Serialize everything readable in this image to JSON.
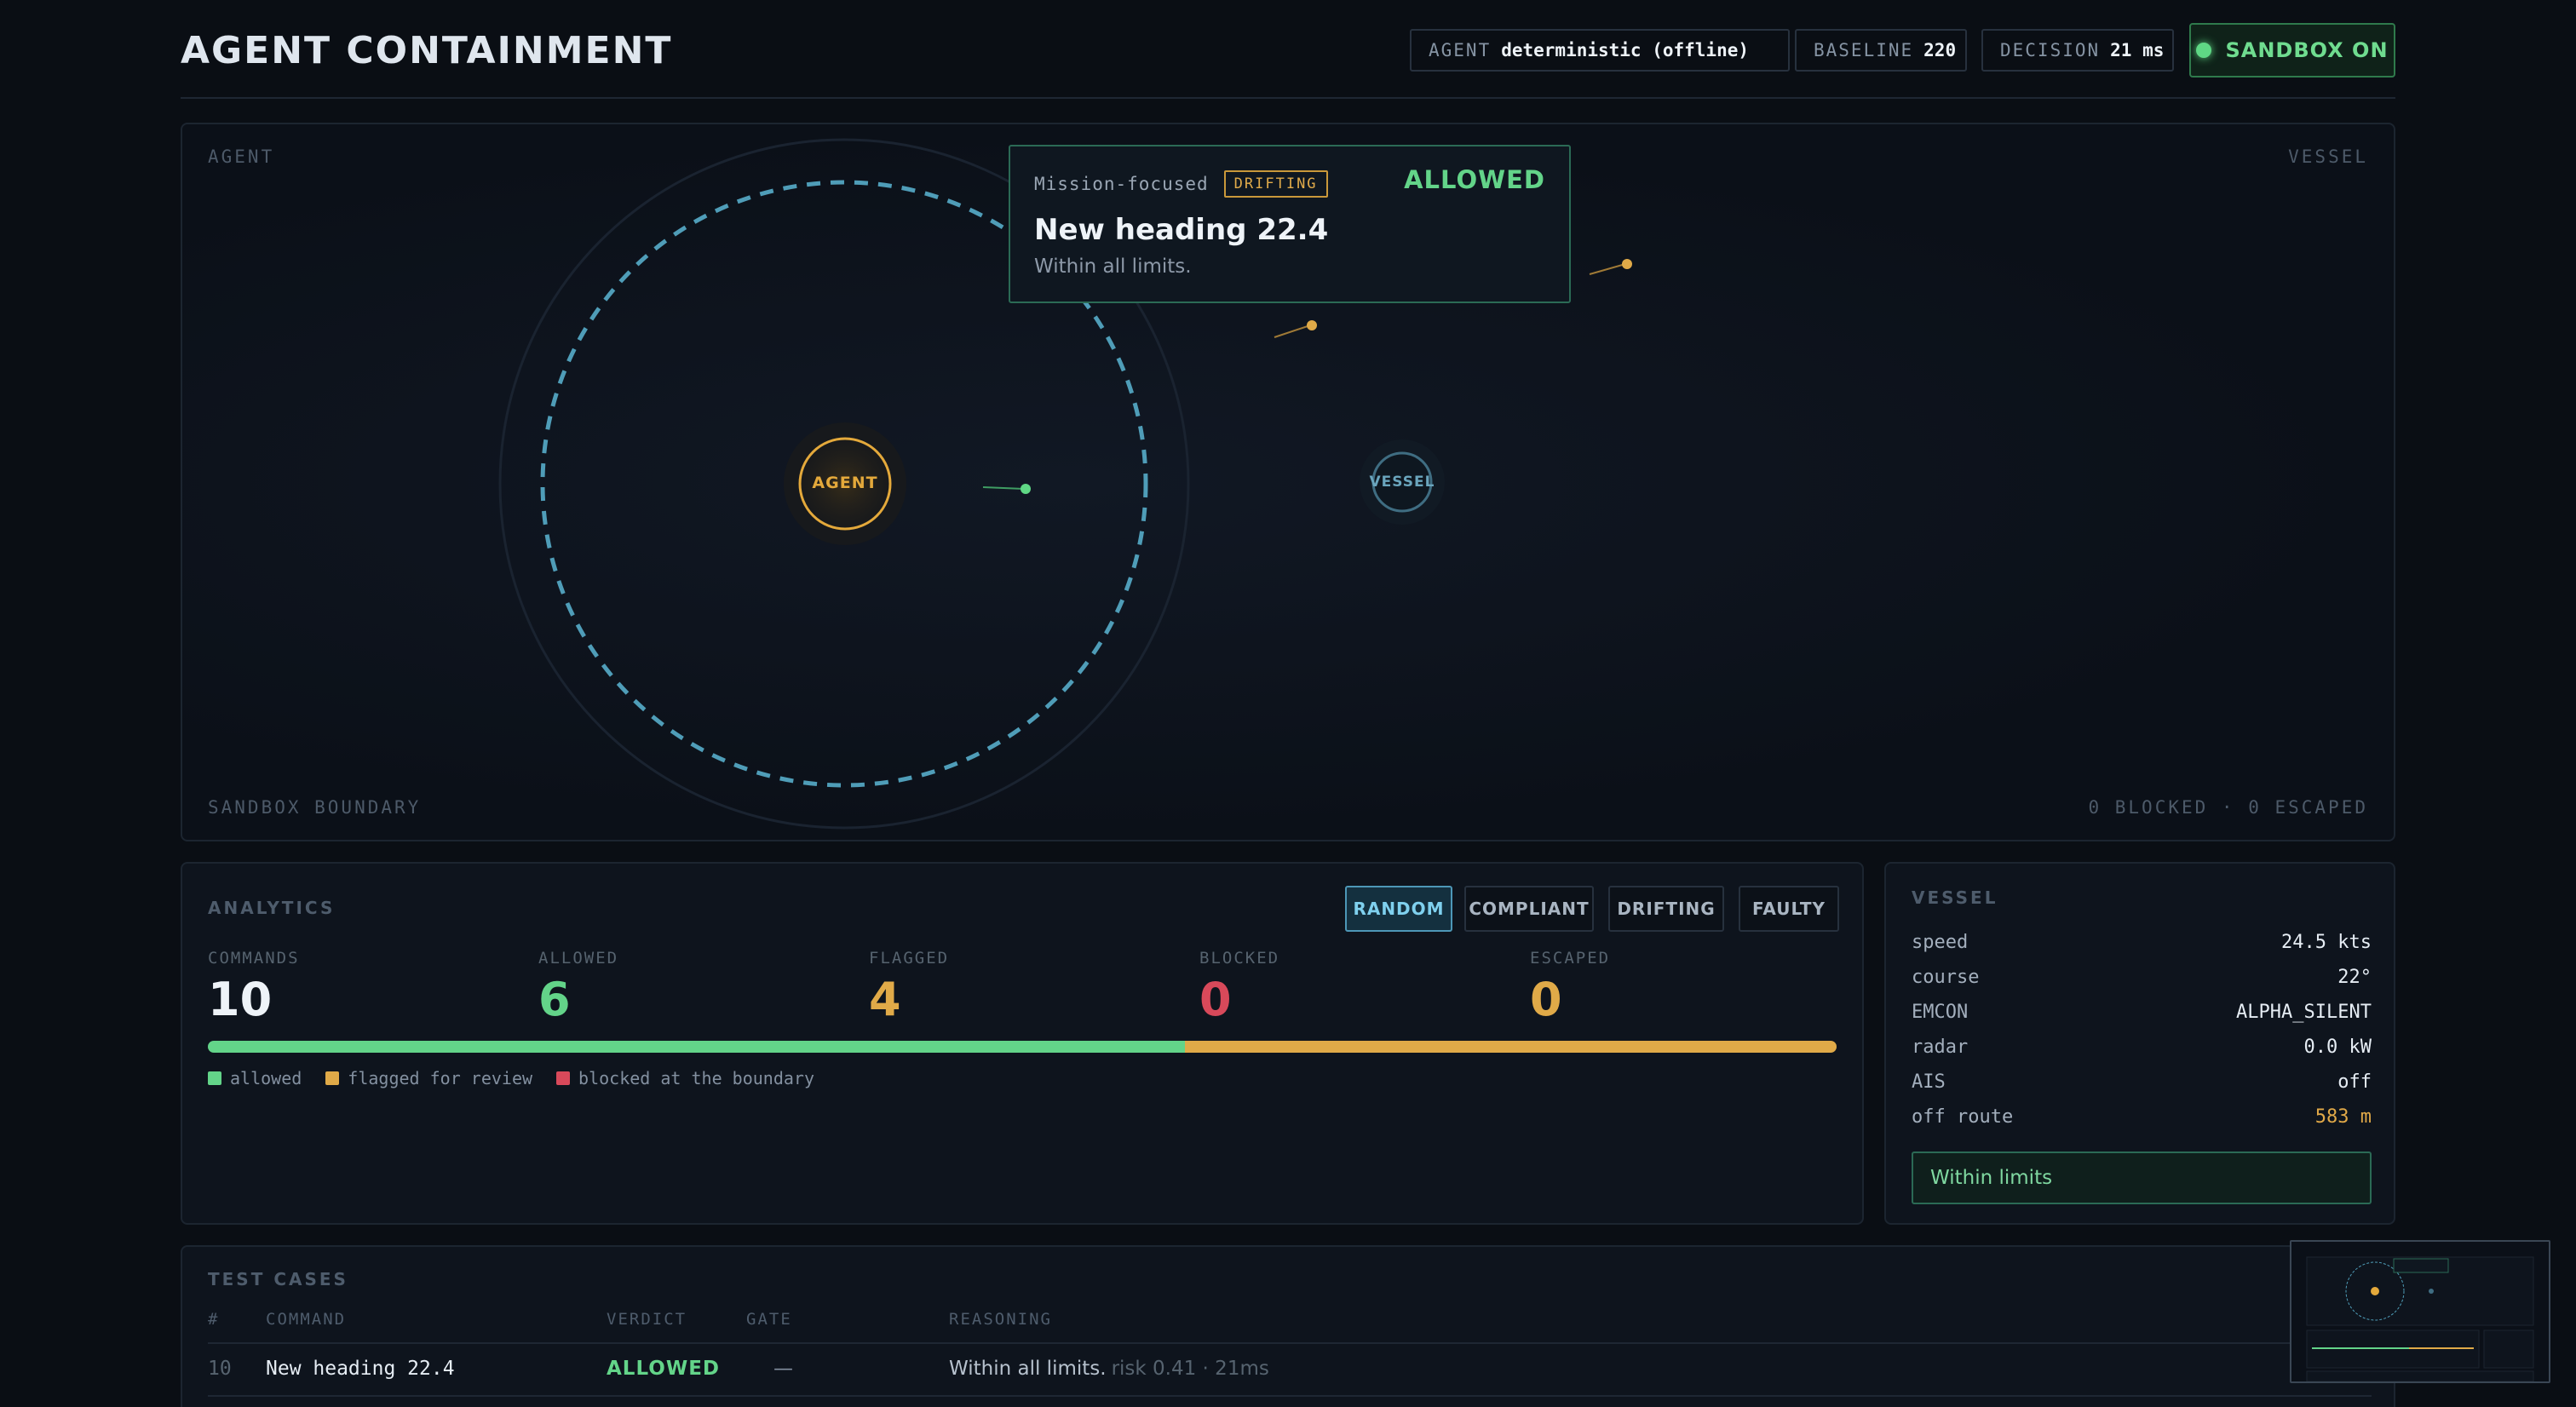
{
  "header": {
    "title": "AGENT CONTAINMENT",
    "agent_key": "AGENT",
    "agent_value": "deterministic (offline)",
    "baseline_key": "BASELINE",
    "baseline_value": "220",
    "decision_key": "DECISION",
    "decision_value": "21 ms",
    "sandbox_label": "SANDBOX ON"
  },
  "stage": {
    "label_tl": "AGENT",
    "label_tr": "VESSEL",
    "label_bl": "SANDBOX BOUNDARY",
    "label_br": "0 BLOCKED · 0 ESCAPED",
    "agent_node": "AGENT",
    "vessel_node": "VESSEL"
  },
  "tooltip": {
    "type": "Mission-focused",
    "badge": "DRIFTING",
    "verdict": "ALLOWED",
    "title": "New heading 22.4",
    "subtitle": "Within all limits."
  },
  "analytics": {
    "title": "ANALYTICS",
    "modes": [
      "RANDOM",
      "COMPLIANT",
      "DRIFTING",
      "FAULTY"
    ],
    "active_mode": "RANDOM",
    "stats": {
      "commands_label": "COMMANDS",
      "commands": "10",
      "allowed_label": "ALLOWED",
      "allowed": "6",
      "flagged_label": "FLAGGED",
      "flagged": "4",
      "blocked_label": "BLOCKED",
      "blocked": "0",
      "escaped_label": "ESCAPED",
      "escaped": "0"
    },
    "distribution": {
      "allowed": 6,
      "flagged": 4,
      "blocked": 0
    },
    "legend": {
      "allowed": "allowed",
      "flagged": "flagged for review",
      "blocked": "blocked at the boundary"
    }
  },
  "vessel": {
    "title": "VESSEL",
    "rows": [
      {
        "k": "speed",
        "v": "24.5 kts"
      },
      {
        "k": "course",
        "v": "22°"
      },
      {
        "k": "EMCON",
        "v": "ALPHA_SILENT"
      },
      {
        "k": "radar",
        "v": "0.0 kW"
      },
      {
        "k": "AIS",
        "v": "off"
      },
      {
        "k": "off route",
        "v": "583 m"
      }
    ],
    "status": "Within limits"
  },
  "tests": {
    "title": "TEST CASES",
    "headers": {
      "idx": "#",
      "command": "COMMAND",
      "verdict": "VERDICT",
      "gate": "GATE",
      "reasoning": "REASONING"
    },
    "rows": [
      {
        "idx": "10",
        "command": "New heading 22.4",
        "verdict": "ALLOWED",
        "gate": "—",
        "reasoning": "Within all limits.",
        "meta": "risk 0.41 · 21ms"
      }
    ]
  },
  "colors": {
    "allowed": "#63d489",
    "flagged": "#e0aa48",
    "blocked": "#d8495a",
    "accent": "#4d97b7"
  }
}
